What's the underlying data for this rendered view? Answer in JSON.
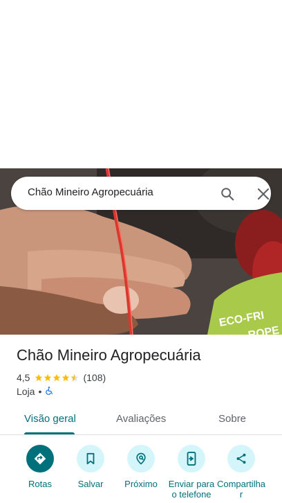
{
  "search": {
    "query": "Chão Mineiro Agropecuária",
    "search_icon": "search-icon",
    "close_icon": "close-icon"
  },
  "photo": {
    "bag_text": "ECO-FRI",
    "bag_text2": "ROPE"
  },
  "place": {
    "name": "Chão Mineiro Agropecuária",
    "rating": "4,5",
    "rating_value": 4.5,
    "review_count": "(108)",
    "category": "Loja",
    "separator": "•",
    "accessibility_icon": "wheelchair-icon"
  },
  "tabs": [
    {
      "label": "Visão geral",
      "active": true
    },
    {
      "label": "Avaliações",
      "active": false
    },
    {
      "label": "Sobre",
      "active": false
    }
  ],
  "actions": [
    {
      "label": "Rotas",
      "icon": "directions-icon"
    },
    {
      "label": "Salvar",
      "icon": "bookmark-icon"
    },
    {
      "label": "Próximo",
      "icon": "nearby-icon"
    },
    {
      "label": "Enviar para o telefone",
      "icon": "send-to-phone-icon"
    },
    {
      "label": "Compartilhar",
      "icon": "share-icon"
    }
  ],
  "colors": {
    "accent": "#00707a",
    "star": "#fbbc04",
    "action_bg": "#d4f6fb"
  }
}
